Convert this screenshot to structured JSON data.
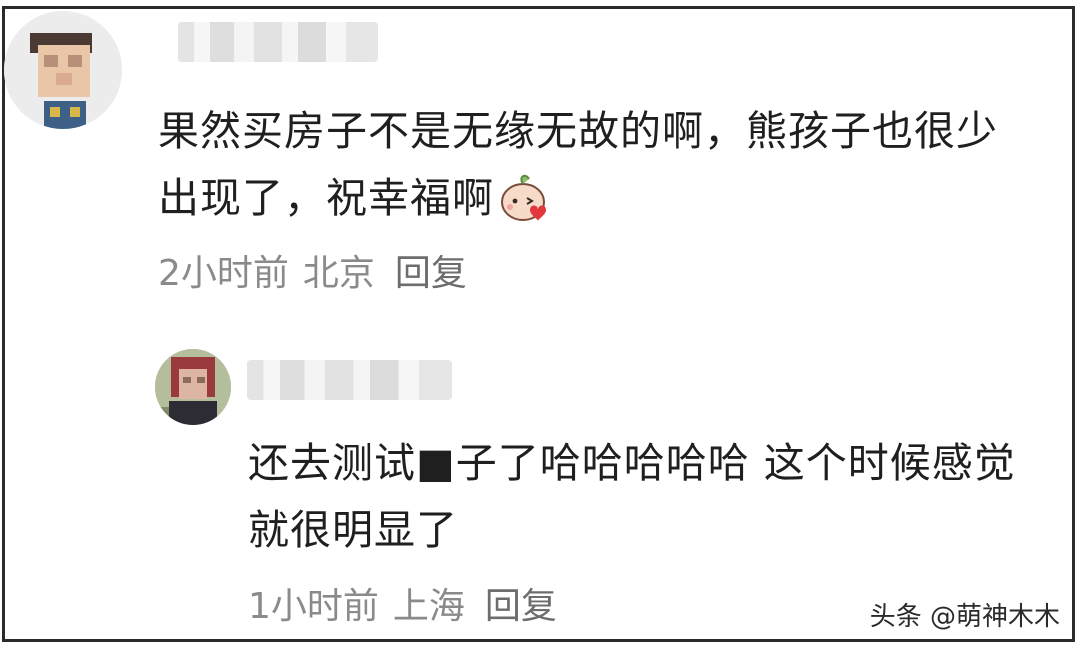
{
  "comments": [
    {
      "username": "",
      "text": "果然买房子不是无缘无故的啊，熊孩子也很少出现了，祝幸福啊",
      "emoji_icon": "kiss-peach-emoji-icon",
      "time": "2小时前",
      "location": "北京",
      "reply_label": "回复"
    },
    {
      "username": "",
      "text": "还去测试■子了哈哈哈哈哈 这个时候感觉就很明显了",
      "time": "1小时前",
      "location": "上海",
      "reply_label": "回复"
    }
  ],
  "watermark": "头条 @萌神木木",
  "colors": {
    "text": "#1f1f1f",
    "meta": "#8a8a8a",
    "border": "#2b2b2b"
  }
}
